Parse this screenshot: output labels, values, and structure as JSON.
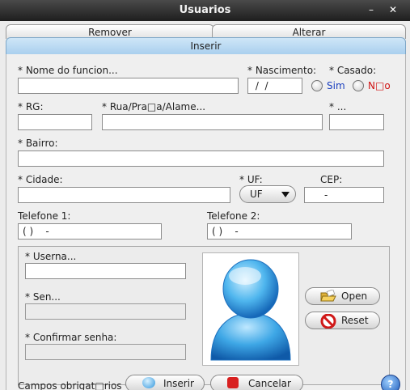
{
  "window": {
    "title": "Usuarios",
    "minimize": "–",
    "close": "✕"
  },
  "tabs": {
    "remover": "Remover",
    "alterar": "Alterar",
    "inserir": "Inserir"
  },
  "form": {
    "nome_label": "* Nome  do funcion...",
    "nome_value": "",
    "nascimento_label": "* Nascimento:",
    "nascimento_value": " /  /",
    "casado_label": "* Casado:",
    "sim_label": "Sim",
    "nao_label": "N□o",
    "rg_label": "* RG:",
    "rg_value": "",
    "rua_label": "* Rua/Pra□a/Alame...",
    "rua_value": "",
    "numero_label": "* ...",
    "numero_value": "",
    "bairro_label": "* Bairro:",
    "bairro_value": "",
    "cidade_label": "* Cidade:",
    "cidade_value": "",
    "uf_label": "* UF:",
    "uf_value": "UF",
    "cep_label": "CEP:",
    "cep_value": "-",
    "tel1_label": "Telefone 1:",
    "tel1_value": "( )    -",
    "tel2_label": "Telefone 2:",
    "tel2_value": "( )    -"
  },
  "account": {
    "username_label": "* Userna...",
    "username_value": "",
    "senha_label": "* Sen...",
    "senha_value": "",
    "confirmar_label": "* Confirmar senha:",
    "confirmar_value": "",
    "open_label": "Open",
    "reset_label": "Reset"
  },
  "footer": {
    "required_note": "Campos obrigat□rios *",
    "inserir_label": "Inserir",
    "cancelar_label": "Cancelar",
    "help_label": "?"
  },
  "colors": {
    "radio_sim": "#1a3fbf",
    "radio_nao": "#d01010",
    "tab_active": "#b7d8f2"
  }
}
